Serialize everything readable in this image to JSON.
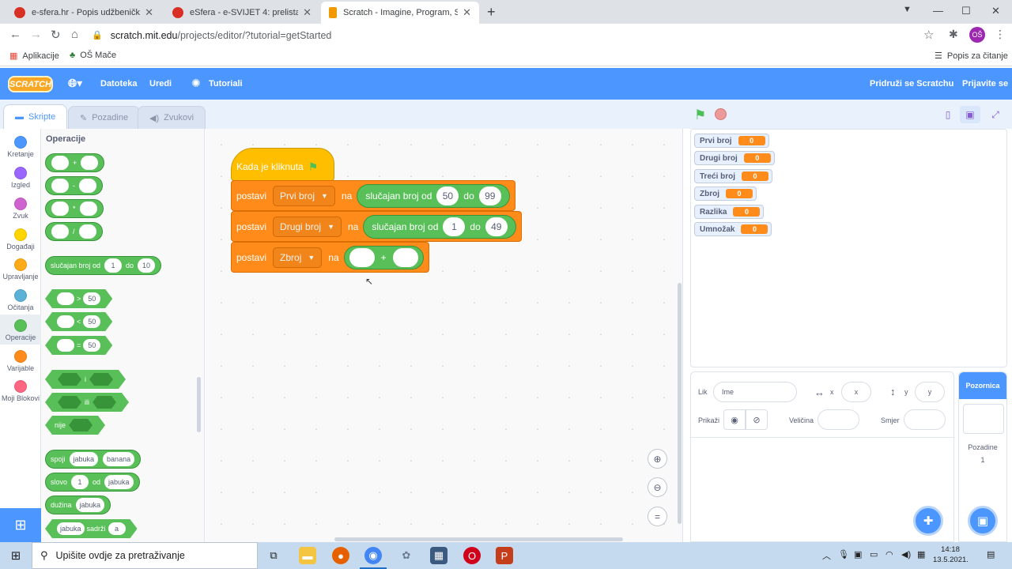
{
  "browser": {
    "tabs": [
      {
        "title": "e-sfera.hr - Popis udžbeničkih ko",
        "color": "#d93025"
      },
      {
        "title": "eSfera - e-SVIJET 4: prelistaj udžb",
        "color": "#d93025"
      },
      {
        "title": "Scratch - Imagine, Program, Shar",
        "color": "#f29900"
      }
    ],
    "url_main": "scratch.mit.edu",
    "url_path": "/projects/editor/?tutorial=getStarted",
    "profile_initials": "OŠ",
    "bookmarks": [
      "Aplikacije",
      "OŠ Mače"
    ],
    "reading_list": "Popis za čitanje"
  },
  "menubar": {
    "logo": "SCRATCH",
    "file": "Datoteka",
    "edit": "Uredi",
    "tutorials": "Tutoriali",
    "join": "Pridruži se Scratchu",
    "signin": "Prijavite se"
  },
  "editor_tabs": [
    "Skripte",
    "Pozadine",
    "Zvukovi"
  ],
  "categories": [
    {
      "label": "Kretanje",
      "color": "#4c97ff"
    },
    {
      "label": "Izgled",
      "color": "#9966ff"
    },
    {
      "label": "Zvuk",
      "color": "#cf63cf"
    },
    {
      "label": "Događaji",
      "color": "#ffd500"
    },
    {
      "label": "Upravljanje",
      "color": "#ffab19"
    },
    {
      "label": "Očitanja",
      "color": "#5cb1d6"
    },
    {
      "label": "Operacije",
      "color": "#59c059"
    },
    {
      "label": "Varijable",
      "color": "#ff8c1a"
    },
    {
      "label": "Moji Blokovi",
      "color": "#ff6680"
    }
  ],
  "palette": {
    "title": "Operacije",
    "ops": [
      "+",
      "-",
      "*",
      "/"
    ],
    "random": {
      "label": "slučajan broj od",
      "from": "1",
      "to_label": "do",
      "to": "10"
    },
    "compare": [
      {
        "op": ">",
        "val": "50"
      },
      {
        "op": "<",
        "val": "50"
      },
      {
        "op": "=",
        "val": "50"
      }
    ],
    "and": "i",
    "or": "ili",
    "not": "nije",
    "join": {
      "label": "spoji",
      "a": "jabuka",
      "b": "banana"
    },
    "letter": {
      "label": "slovo",
      "n": "1",
      "of": "od",
      "word": "jabuka"
    },
    "length": {
      "label": "dužina",
      "word": "jabuka"
    },
    "contains": {
      "word": "jabuka",
      "label": "sadrži",
      "ch": "a"
    }
  },
  "script": {
    "hat": "Kada je kliknuta",
    "set": "postavi",
    "to": "na",
    "from_label": "slučajan broj od",
    "do_label": "do",
    "rows": [
      {
        "var": "Prvi broj",
        "from": "50",
        "to": "99"
      },
      {
        "var": "Drugi broj",
        "from": "1",
        "to": "49"
      }
    ],
    "sum_var": "Zbroj",
    "plus": "+"
  },
  "monitors": [
    {
      "name": "Prvi broj",
      "value": "0"
    },
    {
      "name": "Drugi broj",
      "value": "0"
    },
    {
      "name": "Treći broj",
      "value": "0"
    },
    {
      "name": "Zbroj",
      "value": "0"
    },
    {
      "name": "Razlika",
      "value": "0"
    },
    {
      "name": "Umnožak",
      "value": "0"
    }
  ],
  "sprite_info": {
    "sprite_label": "Lik",
    "name_placeholder": "Ime",
    "x_label": "x",
    "x_placeholder": "x",
    "y_label": "y",
    "y_placeholder": "y",
    "show_label": "Prikaži",
    "size_label": "Veličina",
    "direction_label": "Smjer"
  },
  "stage_pane": {
    "header": "Pozornica",
    "backdrops_label": "Pozadine",
    "backdrops_count": "1"
  },
  "taskbar": {
    "search_placeholder": "Upišite ovdje za pretraživanje",
    "time": "14:18",
    "date": "13.5.2021."
  }
}
